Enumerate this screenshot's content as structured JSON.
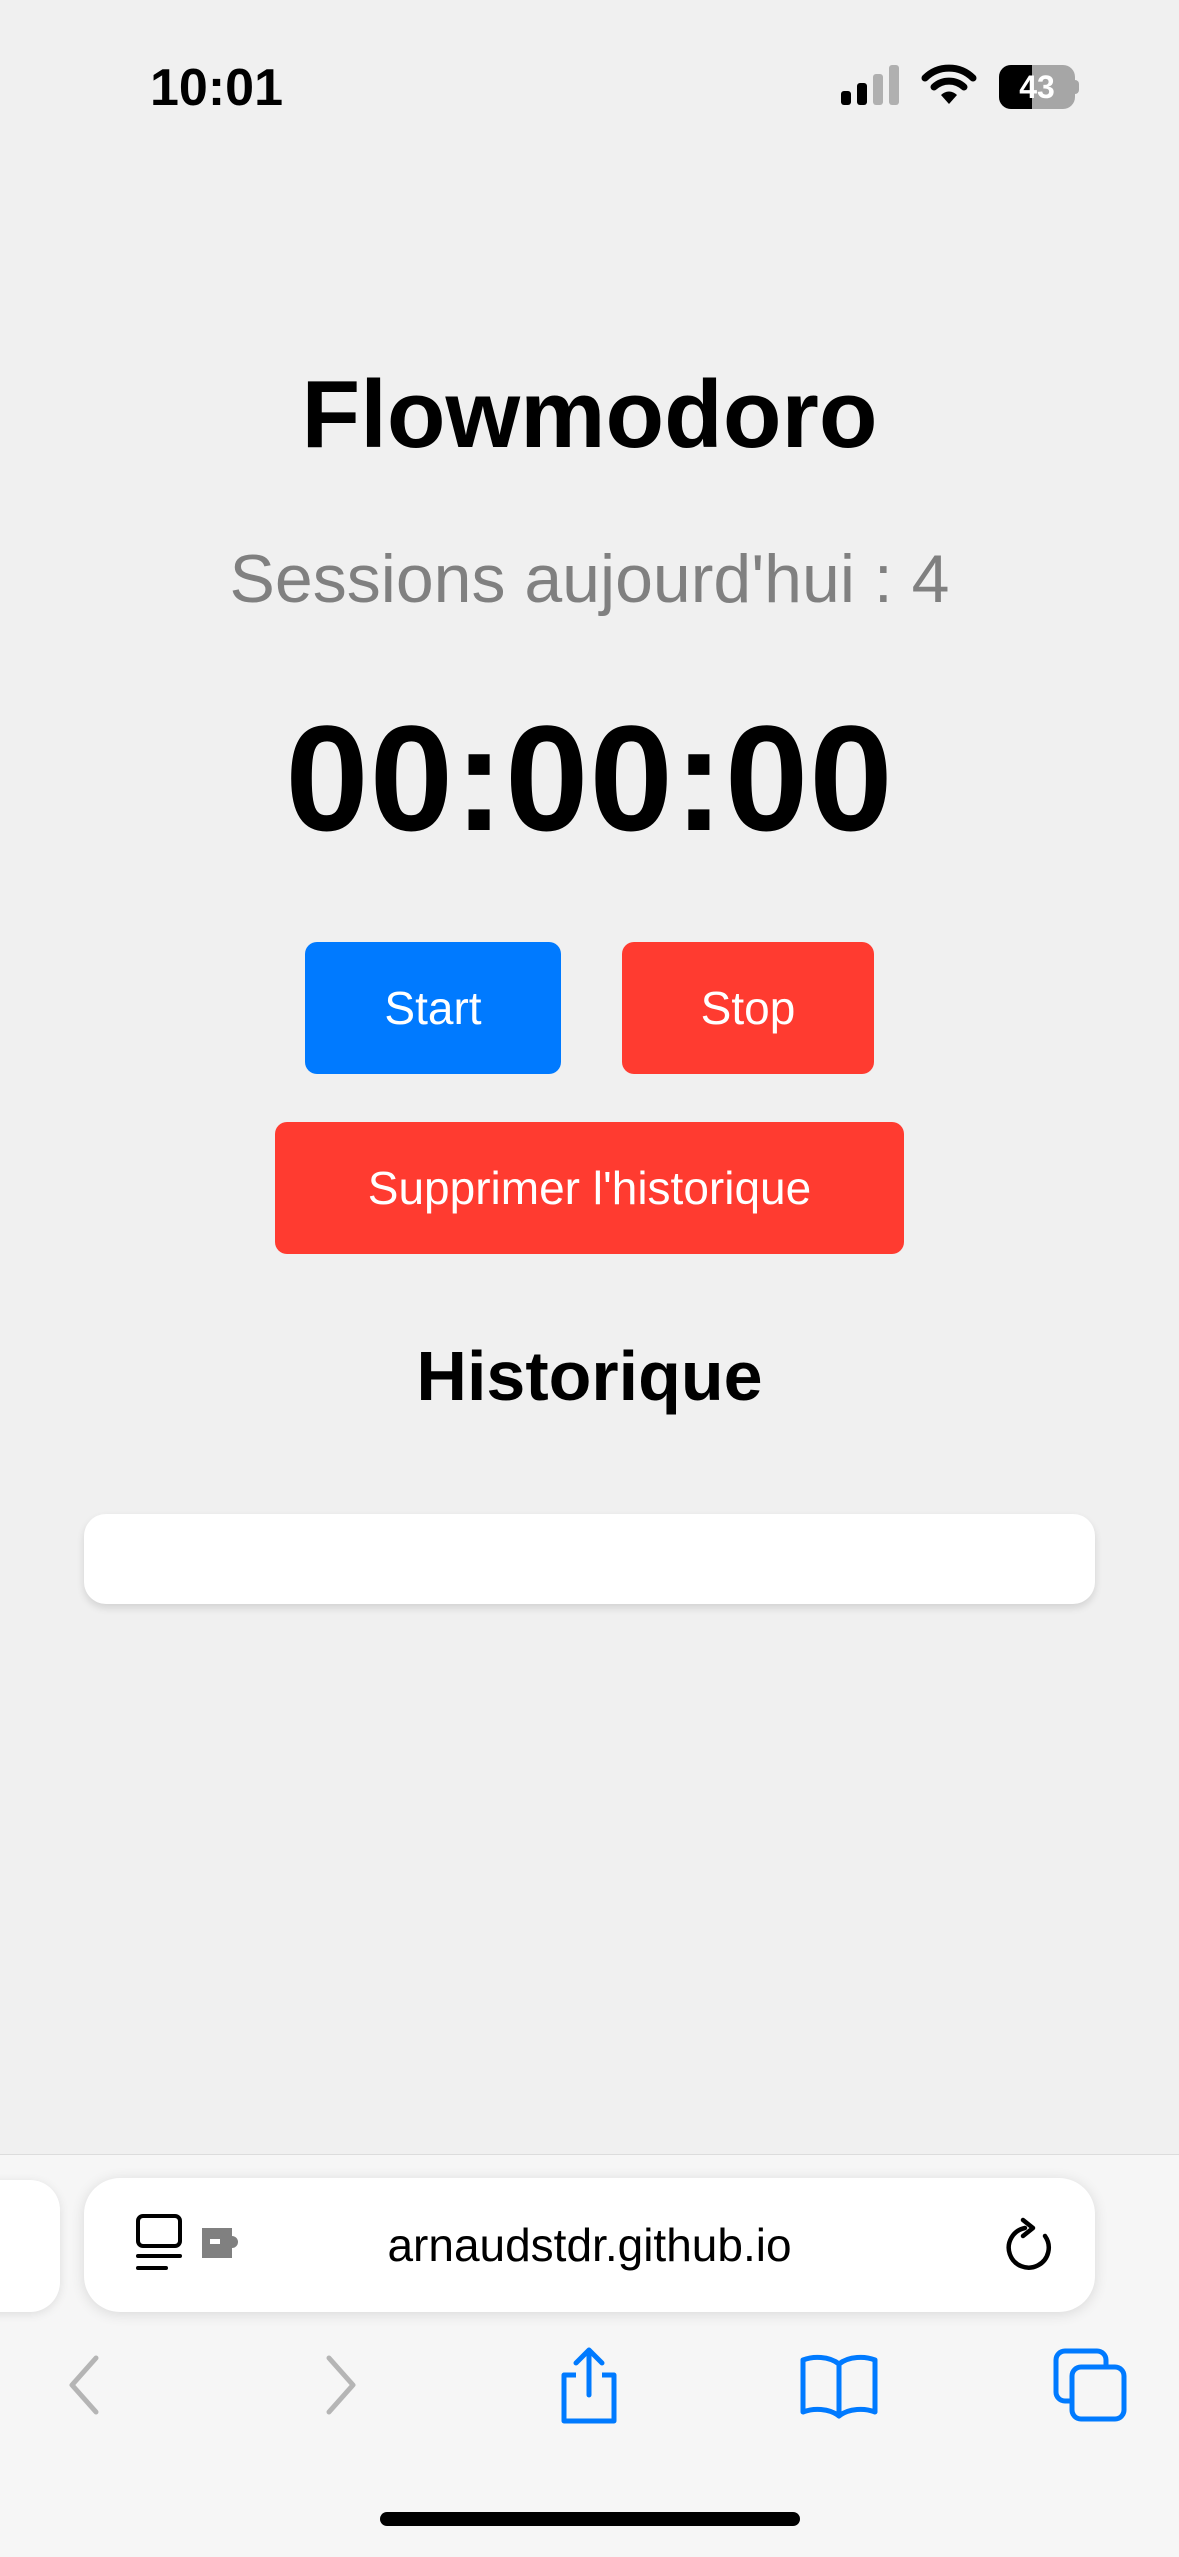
{
  "status_bar": {
    "time": "10:01",
    "battery_level": "43",
    "battery_percent": 43,
    "icons": [
      "cellular-signal-icon",
      "wifi-icon",
      "battery-icon"
    ]
  },
  "app": {
    "title": "Flowmodoro",
    "sessions_label": "Sessions aujourd'hui : 4",
    "timer": "00:00:00",
    "start_label": "Start",
    "stop_label": "Stop",
    "clear_label": "Supprimer l'historique",
    "history_title": "Historique",
    "history_items": []
  },
  "browser": {
    "url": "arnaudstdr.github.io",
    "icons": [
      "page-menu-icon",
      "extension-icon",
      "reload-icon",
      "back-icon",
      "forward-icon",
      "share-icon",
      "bookmarks-icon",
      "tabs-icon"
    ]
  },
  "colors": {
    "background": "#f0f0f0",
    "start_button": "#007aff",
    "stop_button": "#ff3b30",
    "clear_button": "#ff3b30",
    "muted_text": "#808080",
    "browser_accent": "#007aff",
    "disabled_icon": "#b5b5b5"
  }
}
